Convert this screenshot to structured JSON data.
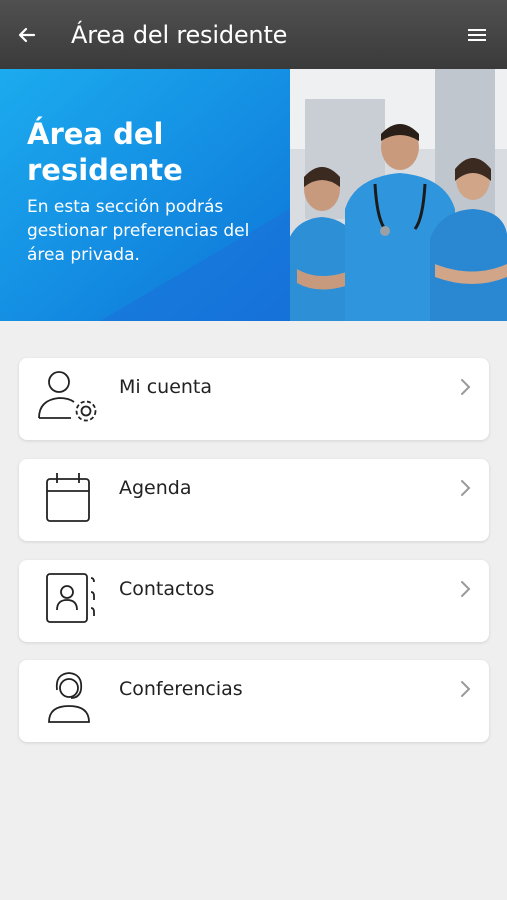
{
  "appbar": {
    "title": "Área del residente",
    "back_icon": "arrow-left-icon",
    "menu_icon": "hamburger-menu-icon"
  },
  "banner": {
    "heading": "Área del residente",
    "description": "En esta sección podrás gestionar preferencias del área privada.",
    "accent_color": "#1487e0"
  },
  "menu_items": [
    {
      "label": "Mi cuenta",
      "icon": "user-settings-icon"
    },
    {
      "label": "Agenda",
      "icon": "calendar-icon"
    },
    {
      "label": "Contactos",
      "icon": "contacts-book-icon"
    },
    {
      "label": "Conferencias",
      "icon": "headset-user-icon"
    }
  ]
}
